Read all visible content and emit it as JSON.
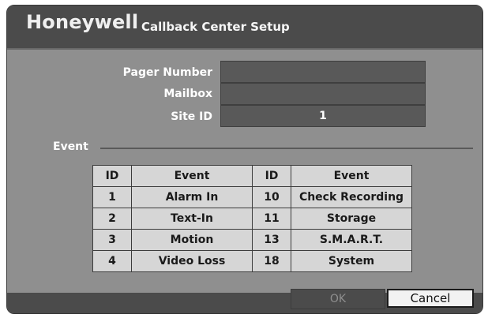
{
  "header": {
    "brand": "Honeywell",
    "title": "Callback Center Setup"
  },
  "fields": {
    "pager_number": {
      "label": "Pager Number",
      "value": ""
    },
    "mailbox": {
      "label": "Mailbox",
      "value": ""
    },
    "site_id": {
      "label": "Site ID",
      "value": "1"
    }
  },
  "event_section": {
    "label": "Event",
    "columns": [
      "ID",
      "Event",
      "ID",
      "Event"
    ],
    "rows": [
      [
        "1",
        "Alarm In",
        "10",
        "Check Recording"
      ],
      [
        "2",
        "Text-In",
        "11",
        "Storage"
      ],
      [
        "3",
        "Motion",
        "13",
        "S.M.A.R.T."
      ],
      [
        "4",
        "Video Loss",
        "18",
        "System"
      ]
    ]
  },
  "buttons": {
    "ok": "OK",
    "cancel": "Cancel"
  },
  "colors": {
    "panel": "#8f8f8f",
    "titlebar": "#4b4b4b",
    "field": "#595959",
    "table_cell": "#d6d6d6"
  }
}
